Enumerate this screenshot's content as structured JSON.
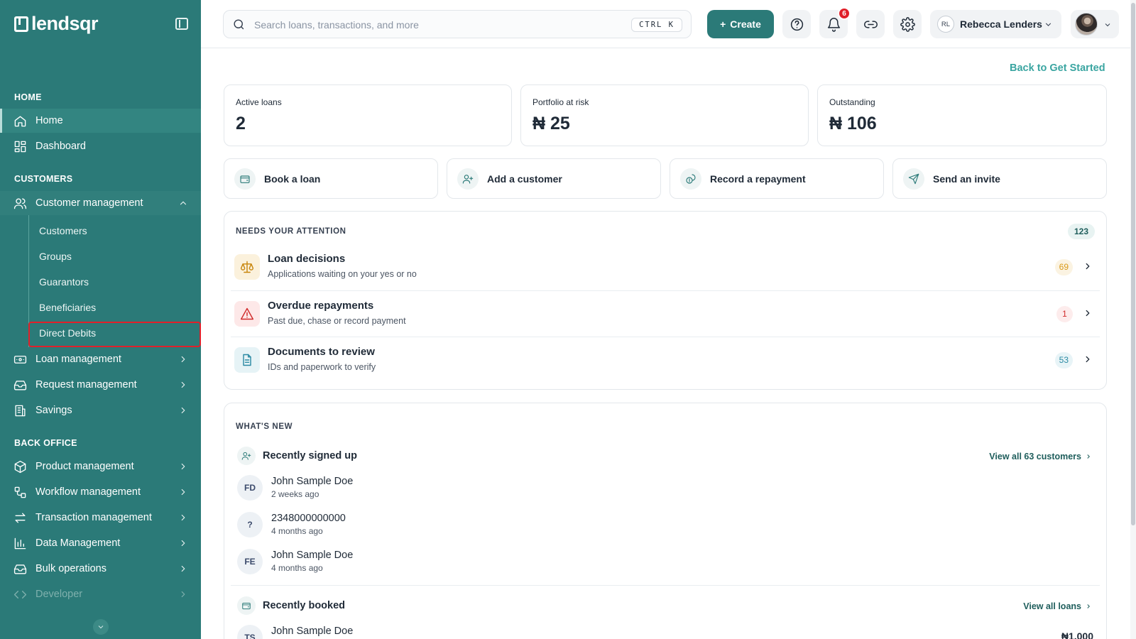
{
  "brand": {
    "name": "lendsqr"
  },
  "sidebar": {
    "sections": {
      "home": "HOME",
      "customers": "CUSTOMERS",
      "back_office": "BACK OFFICE"
    },
    "items": {
      "home": "Home",
      "dashboard": "Dashboard",
      "customer_management": "Customer management",
      "loan_management": "Loan management",
      "request_management": "Request management",
      "savings": "Savings",
      "product_management": "Product management",
      "workflow_management": "Workflow management",
      "transaction_management": "Transaction management",
      "data_management": "Data Management",
      "bulk_operations": "Bulk operations",
      "developer": "Developer"
    },
    "customer_submenu": [
      "Customers",
      "Groups",
      "Guarantors",
      "Beneficiaries",
      "Direct Debits"
    ],
    "selected_submenu": "Direct Debits"
  },
  "topbar": {
    "search_placeholder": "Search loans, transactions, and more",
    "shortcut": "CTRL K",
    "create_label": "Create",
    "notification_count": "6",
    "org_initials": "RL",
    "org_name": "Rebecca Lenders"
  },
  "main": {
    "back_link": "Back to Get Started",
    "stats": [
      {
        "label": "Active loans",
        "value": "2"
      },
      {
        "label": "Portfolio at risk",
        "value": "₦ 25"
      },
      {
        "label": "Outstanding",
        "value": "₦ 106"
      }
    ],
    "quick_actions": [
      "Book a loan",
      "Add a customer",
      "Record a repayment",
      "Send an invite"
    ],
    "attention": {
      "title": "NEEDS YOUR ATTENTION",
      "total": "123",
      "rows": [
        {
          "title": "Loan decisions",
          "subtitle": "Applications waiting on your yes or no",
          "count": "69"
        },
        {
          "title": "Overdue repayments",
          "subtitle": "Past due, chase or record payment",
          "count": "1"
        },
        {
          "title": "Documents to review",
          "subtitle": "IDs and paperwork to verify",
          "count": "53"
        }
      ]
    },
    "whats_new": {
      "title": "WHAT'S NEW",
      "signed_up": {
        "heading": "Recently signed up",
        "view_all": "View all 63 customers",
        "people": [
          {
            "initials": "FD",
            "name": "John Sample Doe",
            "time": "2 weeks ago"
          },
          {
            "initials": "?",
            "name": "2348000000000",
            "time": "4 months ago"
          },
          {
            "initials": "FE",
            "name": "John Sample Doe",
            "time": "4 months ago"
          }
        ]
      },
      "booked": {
        "heading": "Recently booked",
        "view_all": "View all loans",
        "people": [
          {
            "initials": "TS",
            "name": "John Sample Doe",
            "amount": "₦1,000"
          }
        ]
      }
    }
  },
  "colors": {
    "sidebar_bg": "#2b7a78",
    "accent": "#2b7a78",
    "link": "#3aa5a1",
    "danger": "#e0202a",
    "warning": "#d99a1a"
  }
}
